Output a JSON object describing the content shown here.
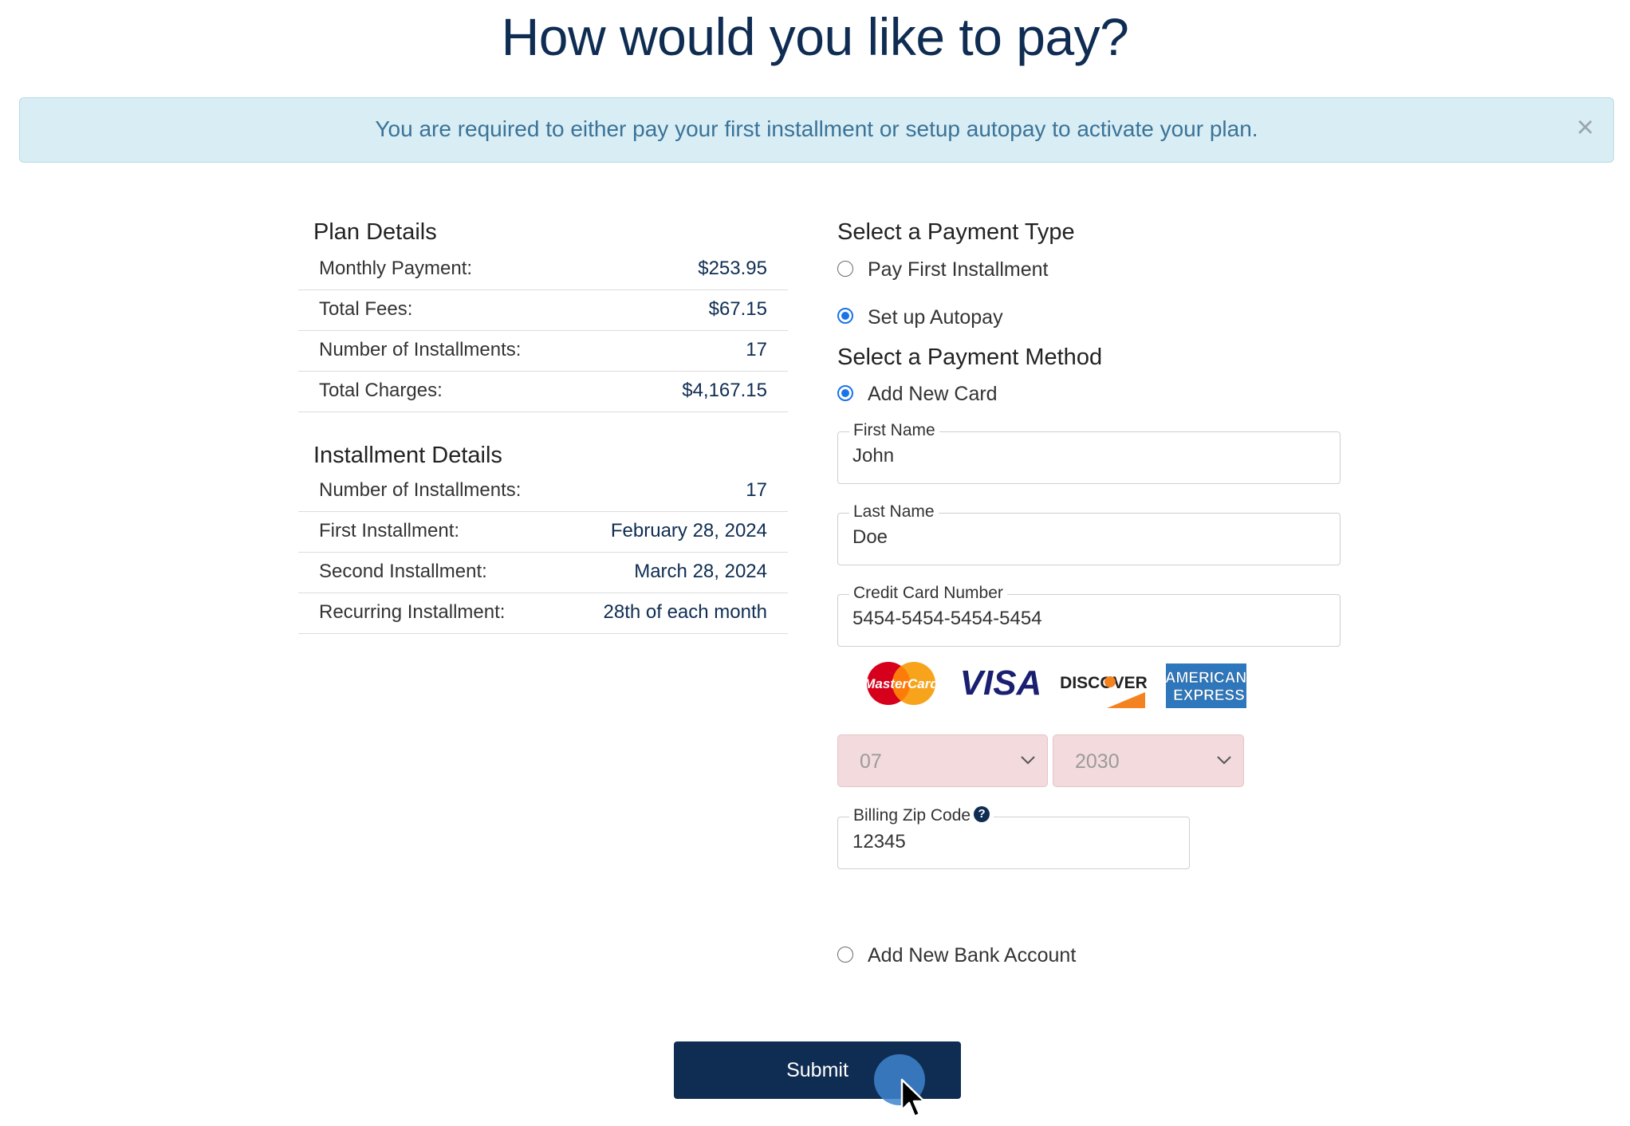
{
  "page": {
    "title": "How would you like to pay?"
  },
  "alert": {
    "message": "You are required to either pay your first installment or setup autopay to activate your plan.",
    "close_glyph": "×"
  },
  "plan_details": {
    "heading": "Plan Details",
    "rows": [
      {
        "label": "Monthly Payment:",
        "value": "$253.95"
      },
      {
        "label": "Total Fees:",
        "value": "$67.15"
      },
      {
        "label": "Number of Installments:",
        "value": "17"
      },
      {
        "label": "Total Charges:",
        "value": "$4,167.15"
      }
    ]
  },
  "installment_details": {
    "heading": "Installment Details",
    "rows": [
      {
        "label": "Number of Installments:",
        "value": "17"
      },
      {
        "label": "First Installment:",
        "value": "February 28, 2024"
      },
      {
        "label": "Second Installment:",
        "value": "March 28, 2024"
      },
      {
        "label": "Recurring Installment:",
        "value": "28th of each month"
      }
    ]
  },
  "payment_type": {
    "heading": "Select a Payment Type",
    "options": [
      {
        "label": "Pay First Installment",
        "selected": false
      },
      {
        "label": "Set up Autopay",
        "selected": true
      }
    ]
  },
  "payment_method": {
    "heading": "Select a Payment Method",
    "add_card": {
      "label": "Add New Card",
      "selected": true
    },
    "add_bank": {
      "label": "Add New Bank Account",
      "selected": false
    },
    "fields": {
      "first_name": {
        "label": "First Name",
        "value": "John"
      },
      "last_name": {
        "label": "Last Name",
        "value": "Doe"
      },
      "card_number": {
        "label": "Credit Card Number",
        "value": "5454-5454-5454-5454"
      },
      "zip": {
        "label": "Billing Zip Code",
        "value": "12345",
        "help_glyph": "?"
      }
    },
    "card_logos": {
      "mastercard": "MasterCard",
      "visa": "VISA",
      "discover": "DISCOVER",
      "amex_line1": "AMERICAN",
      "amex_line2": "EXPRESS"
    },
    "expiry_month": "07",
    "expiry_year": "2030"
  },
  "submit": {
    "label": "Submit"
  },
  "colors": {
    "navy": "#0f2d52",
    "alert_bg": "#d9edf5",
    "alert_text": "#3a7397",
    "radio_selected": "#1a73e8",
    "select_bg": "#f3dadc"
  }
}
